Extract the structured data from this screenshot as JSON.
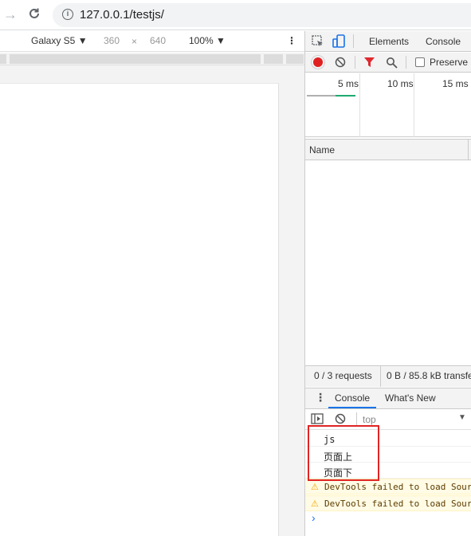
{
  "browser": {
    "url": "127.0.0.1/testjs/"
  },
  "device_toolbar": {
    "device": "Galaxy S5",
    "width": "360",
    "times": "×",
    "height": "640",
    "zoom": "100%"
  },
  "devtools": {
    "tabs": [
      "Elements",
      "Console"
    ],
    "network": {
      "preserve_log": "Preserve l",
      "timeline_labels": [
        "5 ms",
        "10 ms",
        "15 ms"
      ],
      "name_header": "Name",
      "requests": "0 / 3 requests",
      "transferred": "0 B / 85.8 kB transfe"
    },
    "drawer": {
      "tabs": [
        "Console",
        "What's New"
      ],
      "context": "top",
      "messages": [
        "js",
        "页面上",
        "页面下"
      ],
      "warnings": [
        "DevTools failed to load Sour",
        "DevTools failed to load Sour"
      ],
      "prompt": "›"
    }
  },
  "colors": {
    "accent": "#1a73e8",
    "record": "#e02020",
    "highlight_box": "#e02424"
  }
}
